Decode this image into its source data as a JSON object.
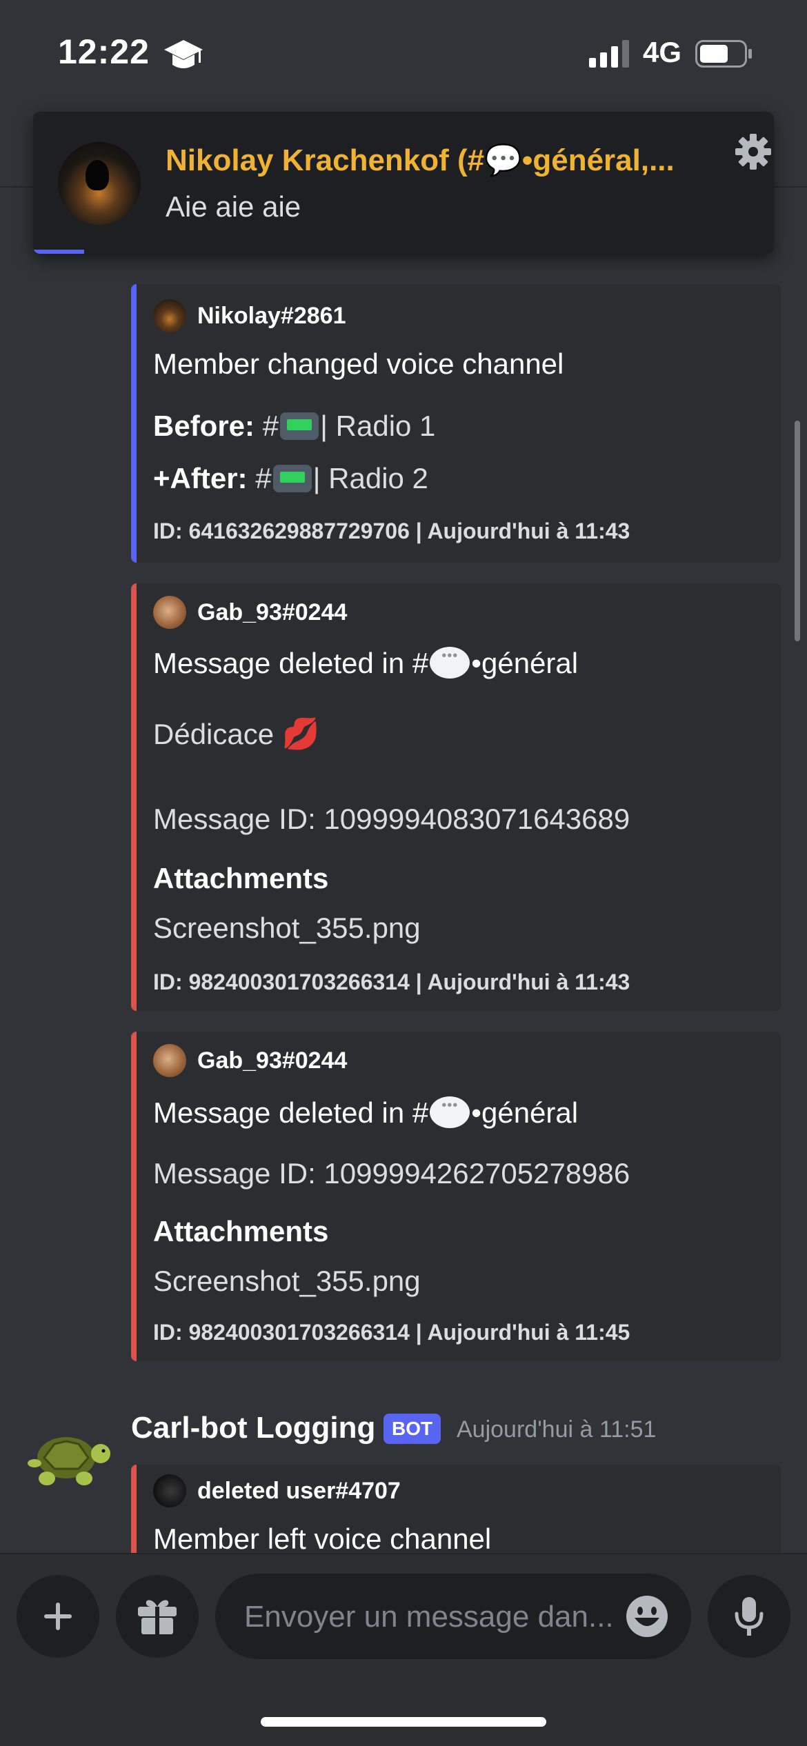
{
  "status_bar": {
    "time": "12:22",
    "network": "4G"
  },
  "notification": {
    "title": "Nikolay Krachenkof (#💬•général,...",
    "text": "Aie aie aie"
  },
  "embeds": [
    {
      "author": "Nikolay#2861",
      "title": "Member changed voice channel",
      "before_label": "Before:",
      "before_prefix": "#",
      "before_channel": "| Radio 1",
      "after_label": "+After:",
      "after_prefix": "#",
      "after_channel": "| Radio 2",
      "footer": "ID: 641632629887729706 | Aujourd'hui à 11:43"
    },
    {
      "author": "Gab_93#0244",
      "title_prefix": "Message deleted in #",
      "title_suffix": "•général",
      "content": "Dédicace",
      "content_emoji": "💋",
      "message_id": "Message ID: 1099994083071643689",
      "attachments_label": "Attachments",
      "attachment": "Screenshot_355.png",
      "footer": "ID: 982400301703266314 | Aujourd'hui à 11:43"
    },
    {
      "author": "Gab_93#0244",
      "title_prefix": "Message deleted in #",
      "title_suffix": "•général",
      "message_id": "Message ID: 1099994262705278986",
      "attachments_label": "Attachments",
      "attachment": "Screenshot_355.png",
      "footer": "ID: 982400301703266314 | Aujourd'hui à 11:45"
    },
    {
      "author": "deleted user#4707",
      "title": "Member left voice channel"
    }
  ],
  "bot_message": {
    "name": "Carl-bot Logging",
    "badge": "BOT",
    "time": "Aujourd'hui à 11:51"
  },
  "composer": {
    "placeholder": "Envoyer un message dan..."
  },
  "colors": {
    "background": "#313338",
    "embed_bg": "#2b2d31",
    "embed_blue": "#5865f2",
    "embed_red": "#d9534f",
    "notif_title": "#f0b232"
  }
}
